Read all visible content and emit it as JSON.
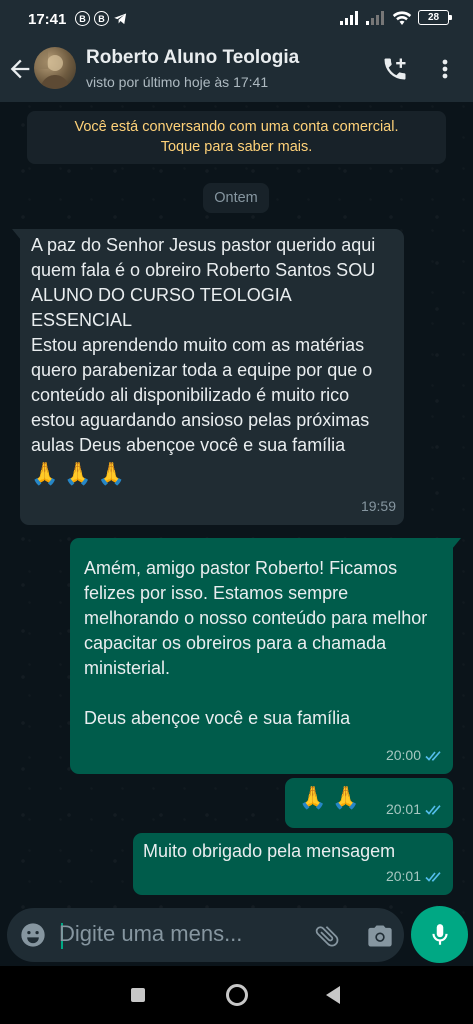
{
  "status_bar": {
    "time": "17:41",
    "left_icons": [
      "B",
      "B"
    ],
    "battery": "28"
  },
  "header": {
    "contact_name": "Roberto Aluno Teologia",
    "last_seen": "visto por último hoje às 17:41"
  },
  "business_notice": {
    "line1": "Você está conversando com uma conta comercial.",
    "line2": "Toque para saber mais."
  },
  "date_chip": "Ontem",
  "messages": [
    {
      "direction": "in",
      "text": "A paz do Senhor Jesus pastor querido aqui quem fala é o obreiro Roberto Santos SOU ALUNO DO CURSO TEOLOGIA ESSENCIAL\nEstou aprendendo muito com as matérias quero parabenizar toda a equipe por que o conteúdo ali disponibilizado é muito rico estou aguardando ansioso pelas próximas aulas Deus abençoe você e sua família",
      "emojis": "🙏🙏🙏",
      "time": "19:59"
    },
    {
      "direction": "out",
      "text_part1": "Amém, amigo pastor Roberto! Ficamos felizes por isso. Estamos sempre melhorando o nosso conteúdo para melhor capacitar os obreiros para a chamada ministerial.",
      "text_part2": "Deus abençoe você e sua família",
      "time": "20:00",
      "status": "read"
    },
    {
      "direction": "out",
      "emojis": "🙏🙏",
      "time": "20:01",
      "status": "read"
    },
    {
      "direction": "out",
      "text": "Muito obrigado pela mensagem",
      "time": "20:01",
      "status": "read"
    }
  ],
  "composer": {
    "placeholder": "Digite uma mens..."
  },
  "colors": {
    "accent": "#00a884",
    "outgoing_bubble": "#005c4b",
    "incoming_bubble": "#202c33",
    "background": "#0b141a",
    "notice_text": "#ffd279",
    "read_ticks": "#53bdeb"
  },
  "icons": [
    "back-arrow-icon",
    "add-call-icon",
    "more-vert-icon",
    "emoji-icon",
    "attach-icon",
    "camera-icon",
    "mic-icon",
    "double-check-icon"
  ]
}
